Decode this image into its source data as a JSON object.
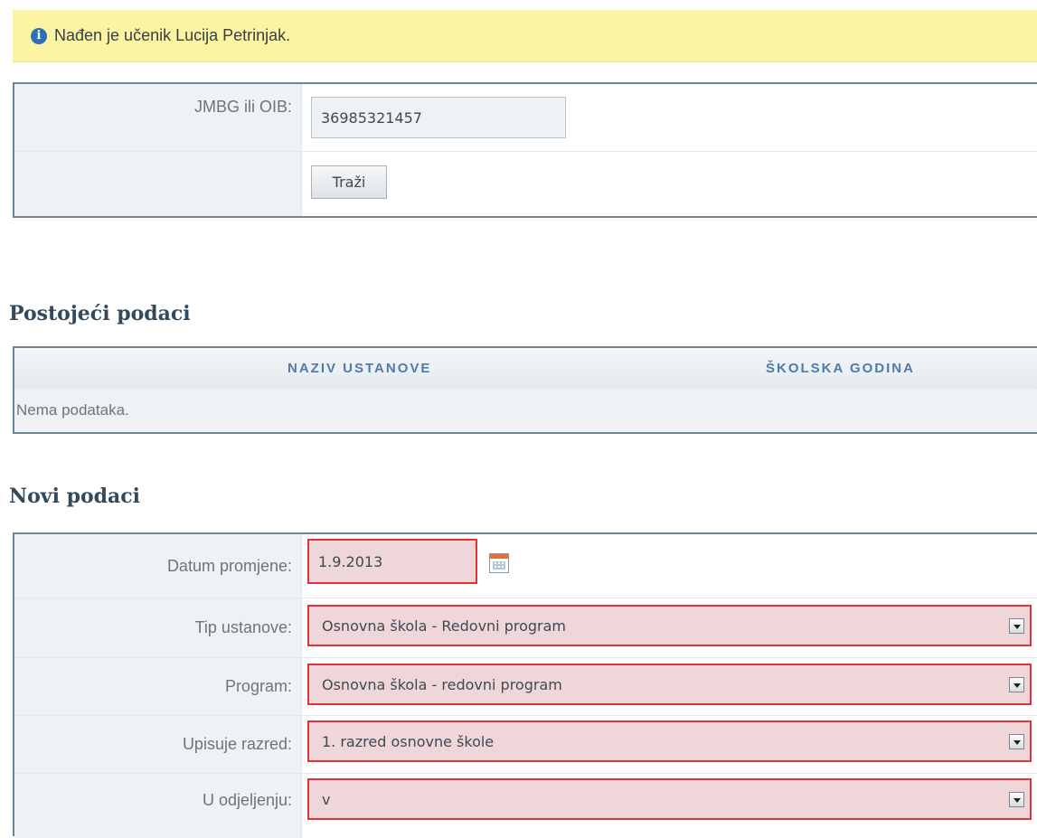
{
  "notice": {
    "icon": "info-icon",
    "text": "Nađen je učenik Lucija Petrinjak."
  },
  "search": {
    "id_label": "JMBG ili OIB:",
    "id_value": "36985321457",
    "search_button": "Traži"
  },
  "existing": {
    "heading": "Postojeći podaci",
    "columns": [
      "NAZIV USTANOVE",
      "ŠKOLSKA GODINA"
    ],
    "empty_text": "Nema podataka."
  },
  "new_data": {
    "heading": "Novi podaci",
    "date_label": "Datum promjene:",
    "date_value": "1.9.2013",
    "institution_type_label": "Tip ustanove:",
    "institution_type_value": "Osnovna škola - Redovni program",
    "program_label": "Program:",
    "program_value": "Osnovna škola - redovni program",
    "grade_label": "Upisuje razred:",
    "grade_value": "1. razred osnovne škole",
    "class_label": "U odjeljenju:",
    "class_value": "v"
  },
  "colors": {
    "error_border": "#e03339",
    "error_bg": "#efd6d9",
    "notice_bg": "#fbf5a3",
    "frame": "#6f8696"
  }
}
